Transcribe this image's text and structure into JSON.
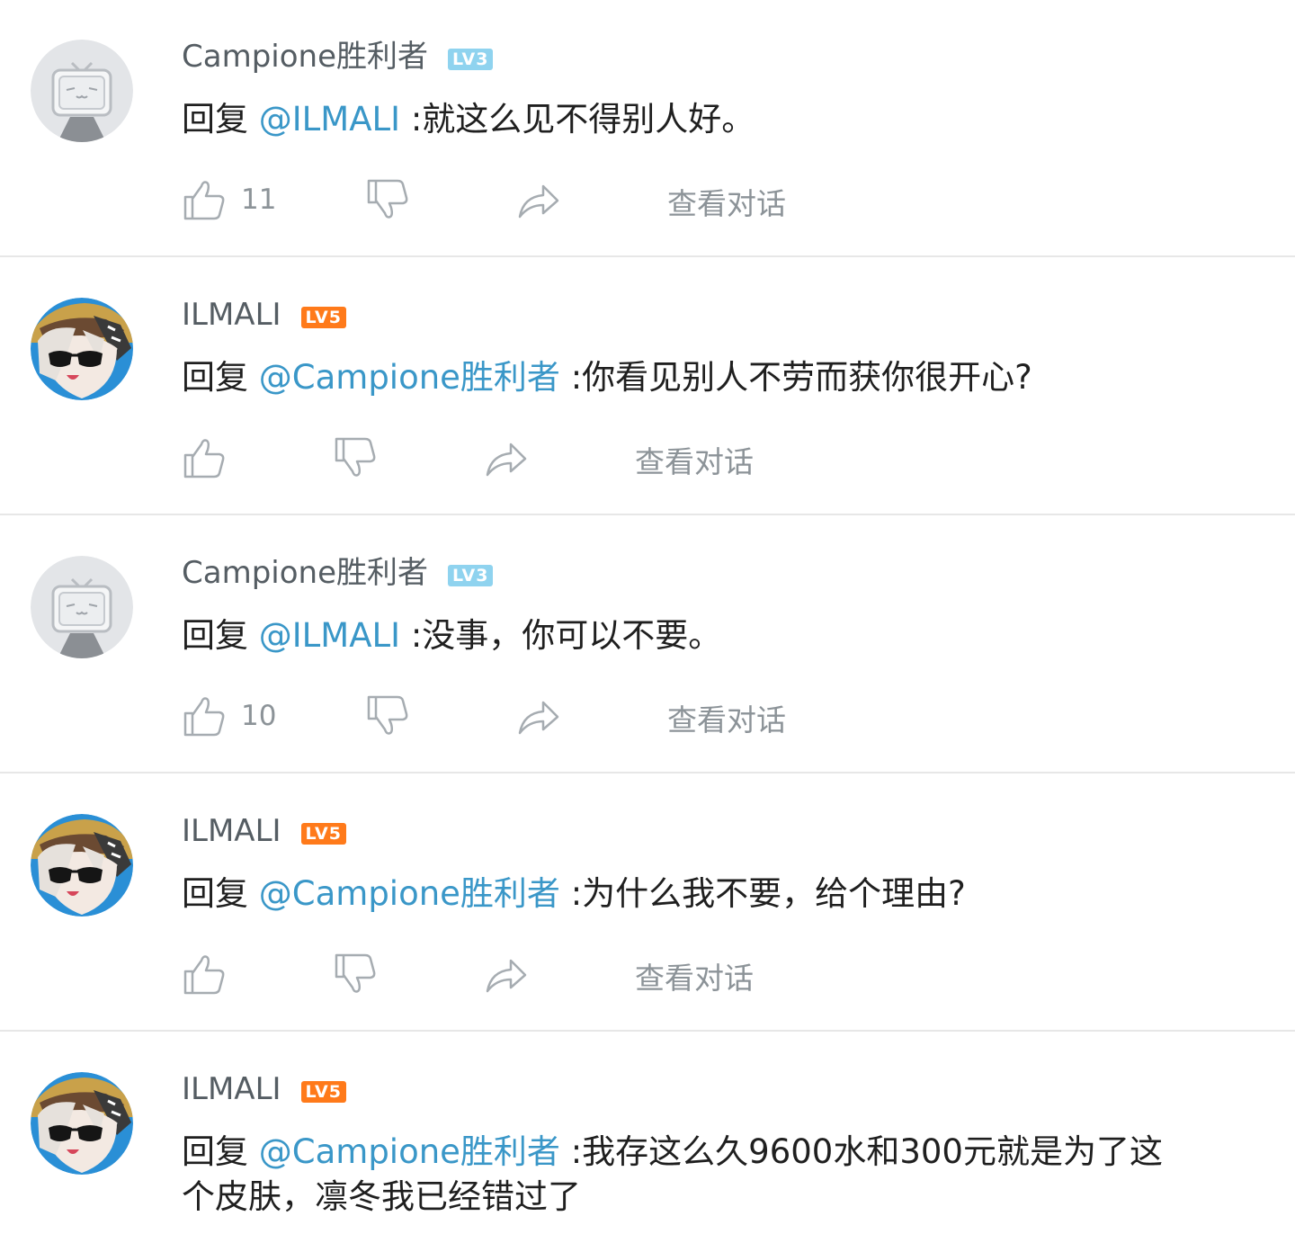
{
  "comments": [
    {
      "username": "Campione胜利者",
      "level": "LV3",
      "reply_prefix": "回复 ",
      "mention": "@ILMALI",
      "text": " :就这么见不得别人好。",
      "like_count": "11",
      "view_label": "查看对话"
    },
    {
      "username": "ILMALI",
      "level": "LV5",
      "reply_prefix": "回复 ",
      "mention": "@Campione胜利者",
      "text": " :你看见别人不劳而获你很开心?",
      "like_count": "",
      "view_label": "查看对话"
    },
    {
      "username": "Campione胜利者",
      "level": "LV3",
      "reply_prefix": "回复 ",
      "mention": "@ILMALI",
      "text": " :没事，你可以不要。",
      "like_count": "10",
      "view_label": "查看对话"
    },
    {
      "username": "ILMALI",
      "level": "LV5",
      "reply_prefix": "回复 ",
      "mention": "@Campione胜利者",
      "text": " :为什么我不要，给个理由?",
      "like_count": "",
      "view_label": "查看对话"
    },
    {
      "username": "ILMALI",
      "level": "LV5",
      "reply_prefix": "回复 ",
      "mention": "@Campione胜利者",
      "text": " :我存这么久9600水和300元就是为了这个皮肤，凛冬我已经错过了"
    }
  ],
  "colors": {
    "mention": "#3a97c8",
    "level3": "#8fd3ef",
    "level5": "#ff7a1a",
    "secondary_text": "#8c9398"
  },
  "icons": {
    "default_avatar": "tv-mascot-avatar",
    "user_avatar": "anime-girl-sunglasses-avatar",
    "like": "thumbs-up-icon",
    "dislike": "thumbs-down-icon",
    "share": "share-arrow-icon"
  }
}
